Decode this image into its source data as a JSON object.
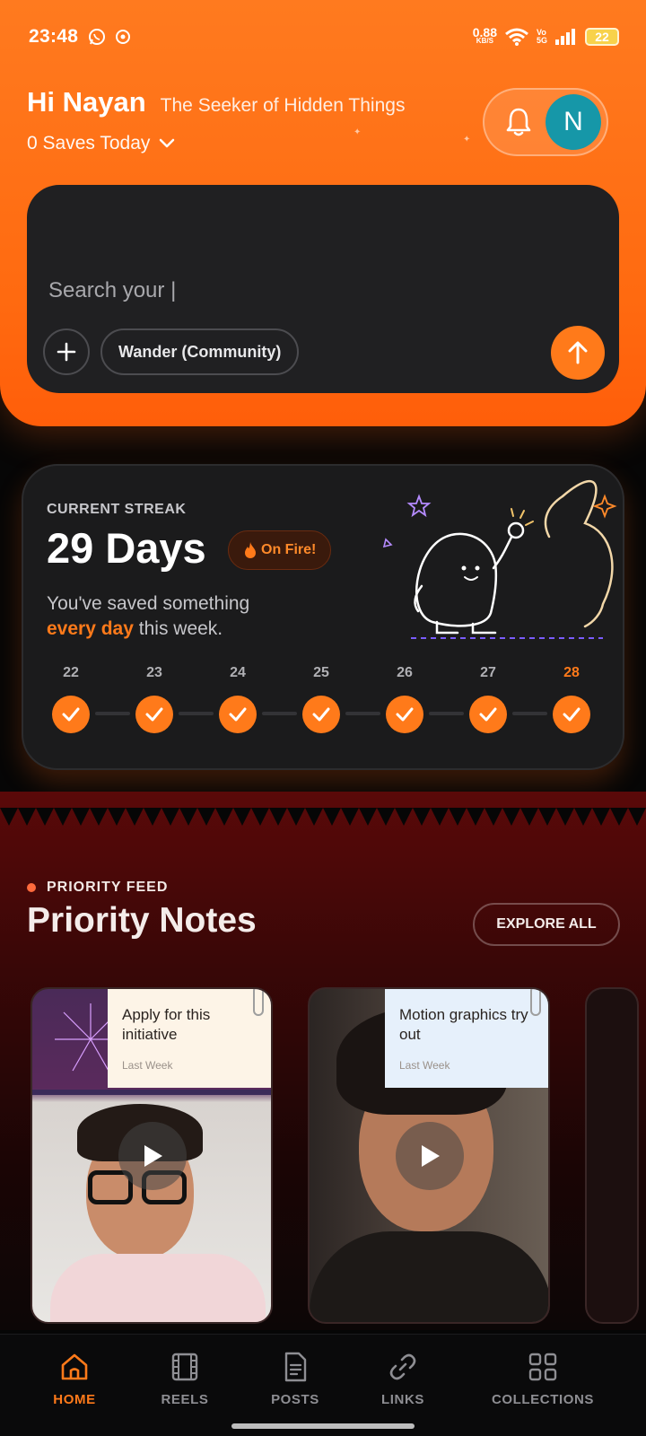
{
  "status_bar": {
    "time": "23:48",
    "net_speed_value": "0.88",
    "net_speed_unit": "KB/S",
    "volte_top": "Vo",
    "volte_bottom": "5G",
    "battery": "22"
  },
  "header": {
    "greeting": "Hi Nayan",
    "tagline": "The Seeker of Hidden Things",
    "saves_today": "0 Saves Today",
    "avatar_initial": "N"
  },
  "search": {
    "placeholder": "Search your |",
    "chip_label": "Wander (Community)"
  },
  "streak": {
    "label": "CURRENT STREAK",
    "days": "29 Days",
    "badge": "On Fire!",
    "desc_prefix": "You've saved something",
    "desc_highlight": "every day",
    "desc_suffix": "this week.",
    "week_days": [
      "22",
      "23",
      "24",
      "25",
      "26",
      "27",
      "28"
    ],
    "completed": [
      true,
      true,
      true,
      true,
      true,
      true,
      true
    ],
    "today": "28"
  },
  "priority": {
    "section_label": "PRIORITY FEED",
    "title": "Priority Notes",
    "explore_label": "EXPLORE ALL",
    "cards": [
      {
        "note": "Apply for this initiative",
        "time": "Last Week"
      },
      {
        "note": "Motion graphics try out",
        "time": "Last Week"
      }
    ]
  },
  "nav": {
    "items": [
      {
        "label": "HOME",
        "icon": "home-icon",
        "active": true
      },
      {
        "label": "REELS",
        "icon": "film-icon",
        "active": false
      },
      {
        "label": "POSTS",
        "icon": "document-icon",
        "active": false
      },
      {
        "label": "LINKS",
        "icon": "link-icon",
        "active": false
      },
      {
        "label": "COLLECTIONS",
        "icon": "grid-icon",
        "active": false
      }
    ]
  },
  "colors": {
    "accent": "#ff7a1a",
    "header_bg": "#ff6a10",
    "avatar_bg": "#1697a8",
    "priority_bg": "#3b0707"
  }
}
